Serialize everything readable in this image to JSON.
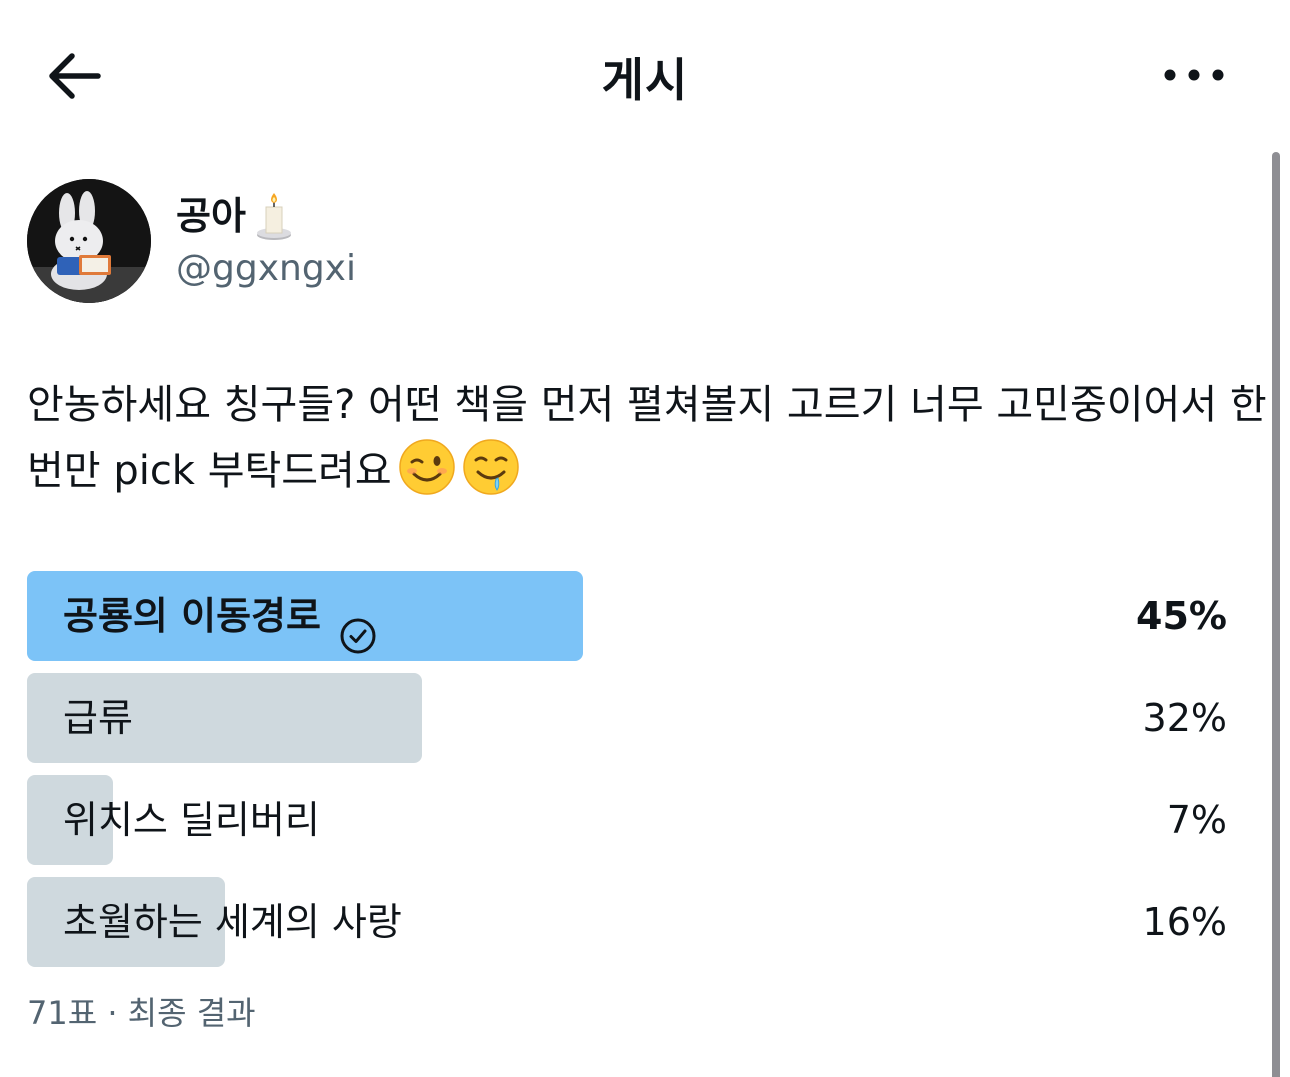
{
  "header": {
    "title": "게시",
    "back_icon": "arrow-left-icon",
    "more_icon": "more-horizontal-icon"
  },
  "author": {
    "display_name": "공아",
    "name_emoji": "candle-icon",
    "handle": "@ggxngxi",
    "avatar": "miffy-plush-reading-avatar"
  },
  "tweet": {
    "text": "안농하세요 칭구들? 어떤 책을 먼저 펼쳐볼지 고르기 너무 고민중이어서 한번만 pick 부탁드려요",
    "emojis": [
      "winking-face-icon",
      "drooling-face-icon"
    ]
  },
  "poll": {
    "options": [
      {
        "label": "공룡의 이동경로",
        "percent_text": "45%",
        "fraction": 0.45,
        "winner": true
      },
      {
        "label": "급류",
        "percent_text": "32%",
        "fraction": 0.32,
        "winner": false
      },
      {
        "label": "위치스 딜리버리",
        "percent_text": "7%",
        "fraction": 0.07,
        "winner": false
      },
      {
        "label": "초월하는 세계의 사랑",
        "percent_text": "16%",
        "fraction": 0.16,
        "winner": false
      }
    ],
    "footer": "71표 · 최종 결과",
    "winner_icon": "check-circle-icon"
  },
  "colors": {
    "winner_bar": "#7cc3f7",
    "other_bar": "#cfd9de",
    "secondary_text": "#536471",
    "primary_text": "#0f1419"
  }
}
